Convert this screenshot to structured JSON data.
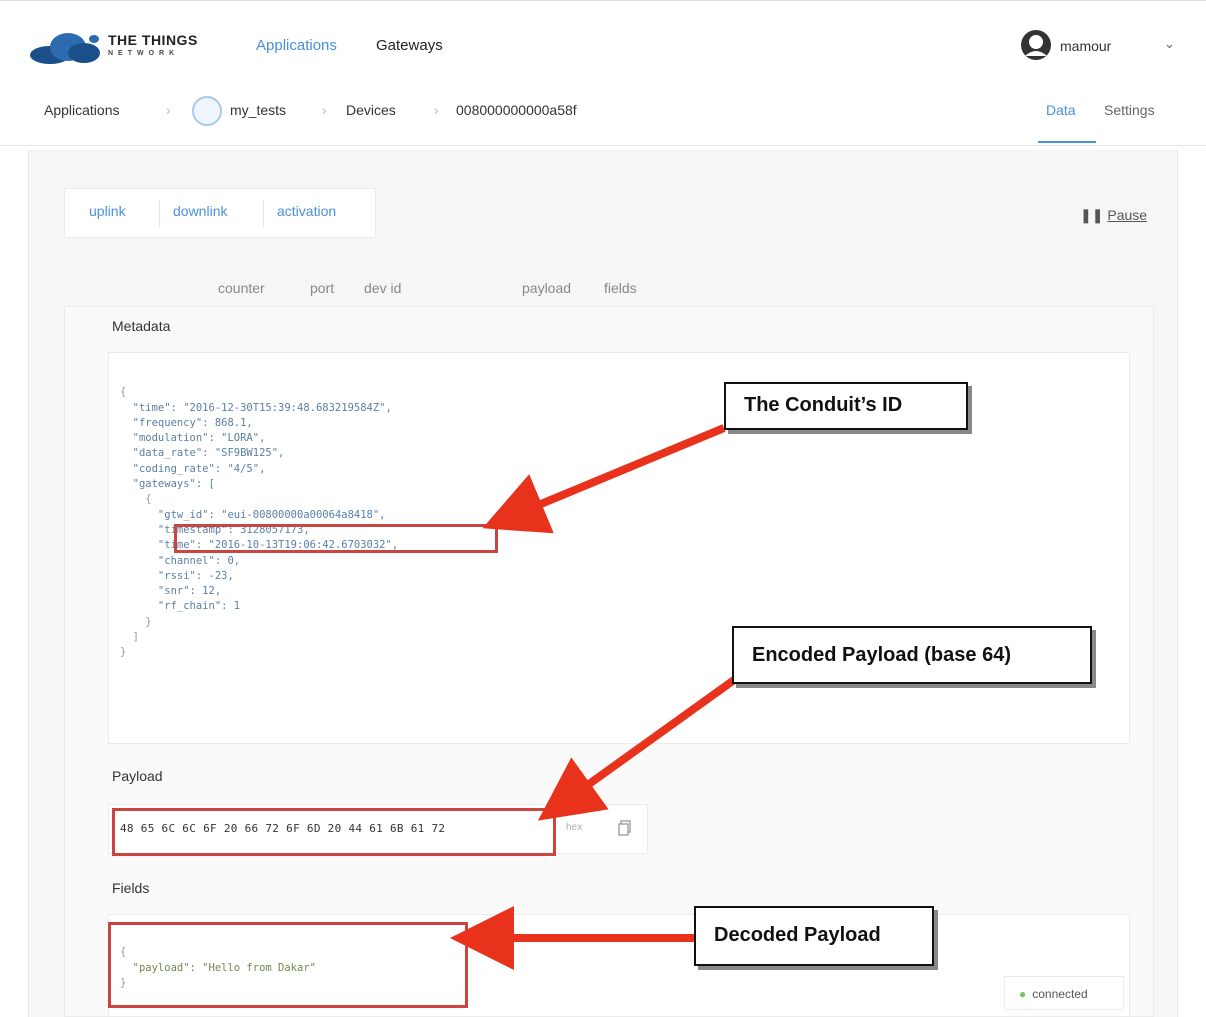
{
  "header": {
    "logo_text": "THE THINGS",
    "logo_subtext": "NETWORK",
    "nav_applications": "Applications",
    "nav_gateways": "Gateways",
    "user_name": "mamour"
  },
  "breadcrumb": {
    "applications": "Applications",
    "app": "my_tests",
    "devices": "Devices",
    "device": "008000000000a58f",
    "tab_data": "Data",
    "tab_settings": "Settings"
  },
  "toggles": {
    "uplink": "uplink",
    "downlink": "downlink",
    "activation": "activation",
    "pause": "Pause"
  },
  "columns": [
    "counter",
    "port",
    "dev id",
    "payload",
    "fields"
  ],
  "metadata": {
    "label": "Metadata",
    "lines": [
      "{",
      "  \"time\": \"2016-12-30T15:39:48.683219584Z\",",
      "  \"frequency\": 868.1,",
      "  \"modulation\": \"LORA\",",
      "  \"data_rate\": \"SF9BW125\",",
      "  \"coding_rate\": \"4/5\",",
      "  \"gateways\": [",
      "    {",
      "      \"gtw_id\": \"eui-00800000a00064a8418\",",
      "      \"timestamp\": 3128057173,",
      "      \"time\": \"2016-10-13T19:06:42.6703032\",",
      "      \"channel\": 0,",
      "      \"rssi\": -23,",
      "      \"snr\": 12,",
      "      \"rf_chain\": 1",
      "    }",
      "  ]",
      "}"
    ]
  },
  "payload": {
    "label": "Payload",
    "hex": "48 65 6C 6C 6F 20 66 72 6F 6D 20 44 61 6B 61 72",
    "format": "hex"
  },
  "fields": {
    "label": "Fields",
    "lines": [
      "{",
      "  \"payload\": \"Hello from Dakar\"",
      "}"
    ]
  },
  "status": {
    "connected": "connected"
  },
  "annotations": {
    "conduit_id": "The Conduit’s ID",
    "encoded_payload": "Encoded Payload (base 64)",
    "decoded_payload": "Decoded Payload",
    "highlight_color": "#c9453f",
    "arrow_color": "#e8321c"
  },
  "colors": {
    "accent": "#4a90d9",
    "connected": "#7cbf6e"
  }
}
